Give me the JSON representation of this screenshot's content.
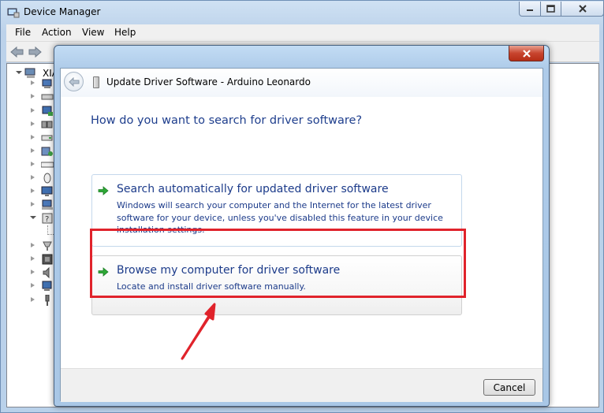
{
  "background_window": {
    "title": "Device Manager",
    "menu": [
      "File",
      "Action",
      "View",
      "Help"
    ],
    "tree_root_label": "XIA"
  },
  "dialog": {
    "title": "Update Driver Software - Arduino Leonardo",
    "question": "How do you want to search for driver software?",
    "options": [
      {
        "title": "Search automatically for updated driver software",
        "description": "Windows will search your computer and the Internet for the latest driver software for your device, unless you've disabled this feature in your device installation settings."
      },
      {
        "title": "Browse my computer for driver software",
        "description": "Locate and install driver software manually."
      }
    ],
    "cancel_label": "Cancel"
  },
  "colors": {
    "annotation_red": "#e0232b",
    "link_blue": "#1c3b8a",
    "arrow_green": "#2ea836"
  },
  "icons": [
    "back-arrow-icon",
    "usb-device-icon",
    "green-arrow-icon",
    "close-icon",
    "minimize-icon",
    "maximize-icon"
  ]
}
